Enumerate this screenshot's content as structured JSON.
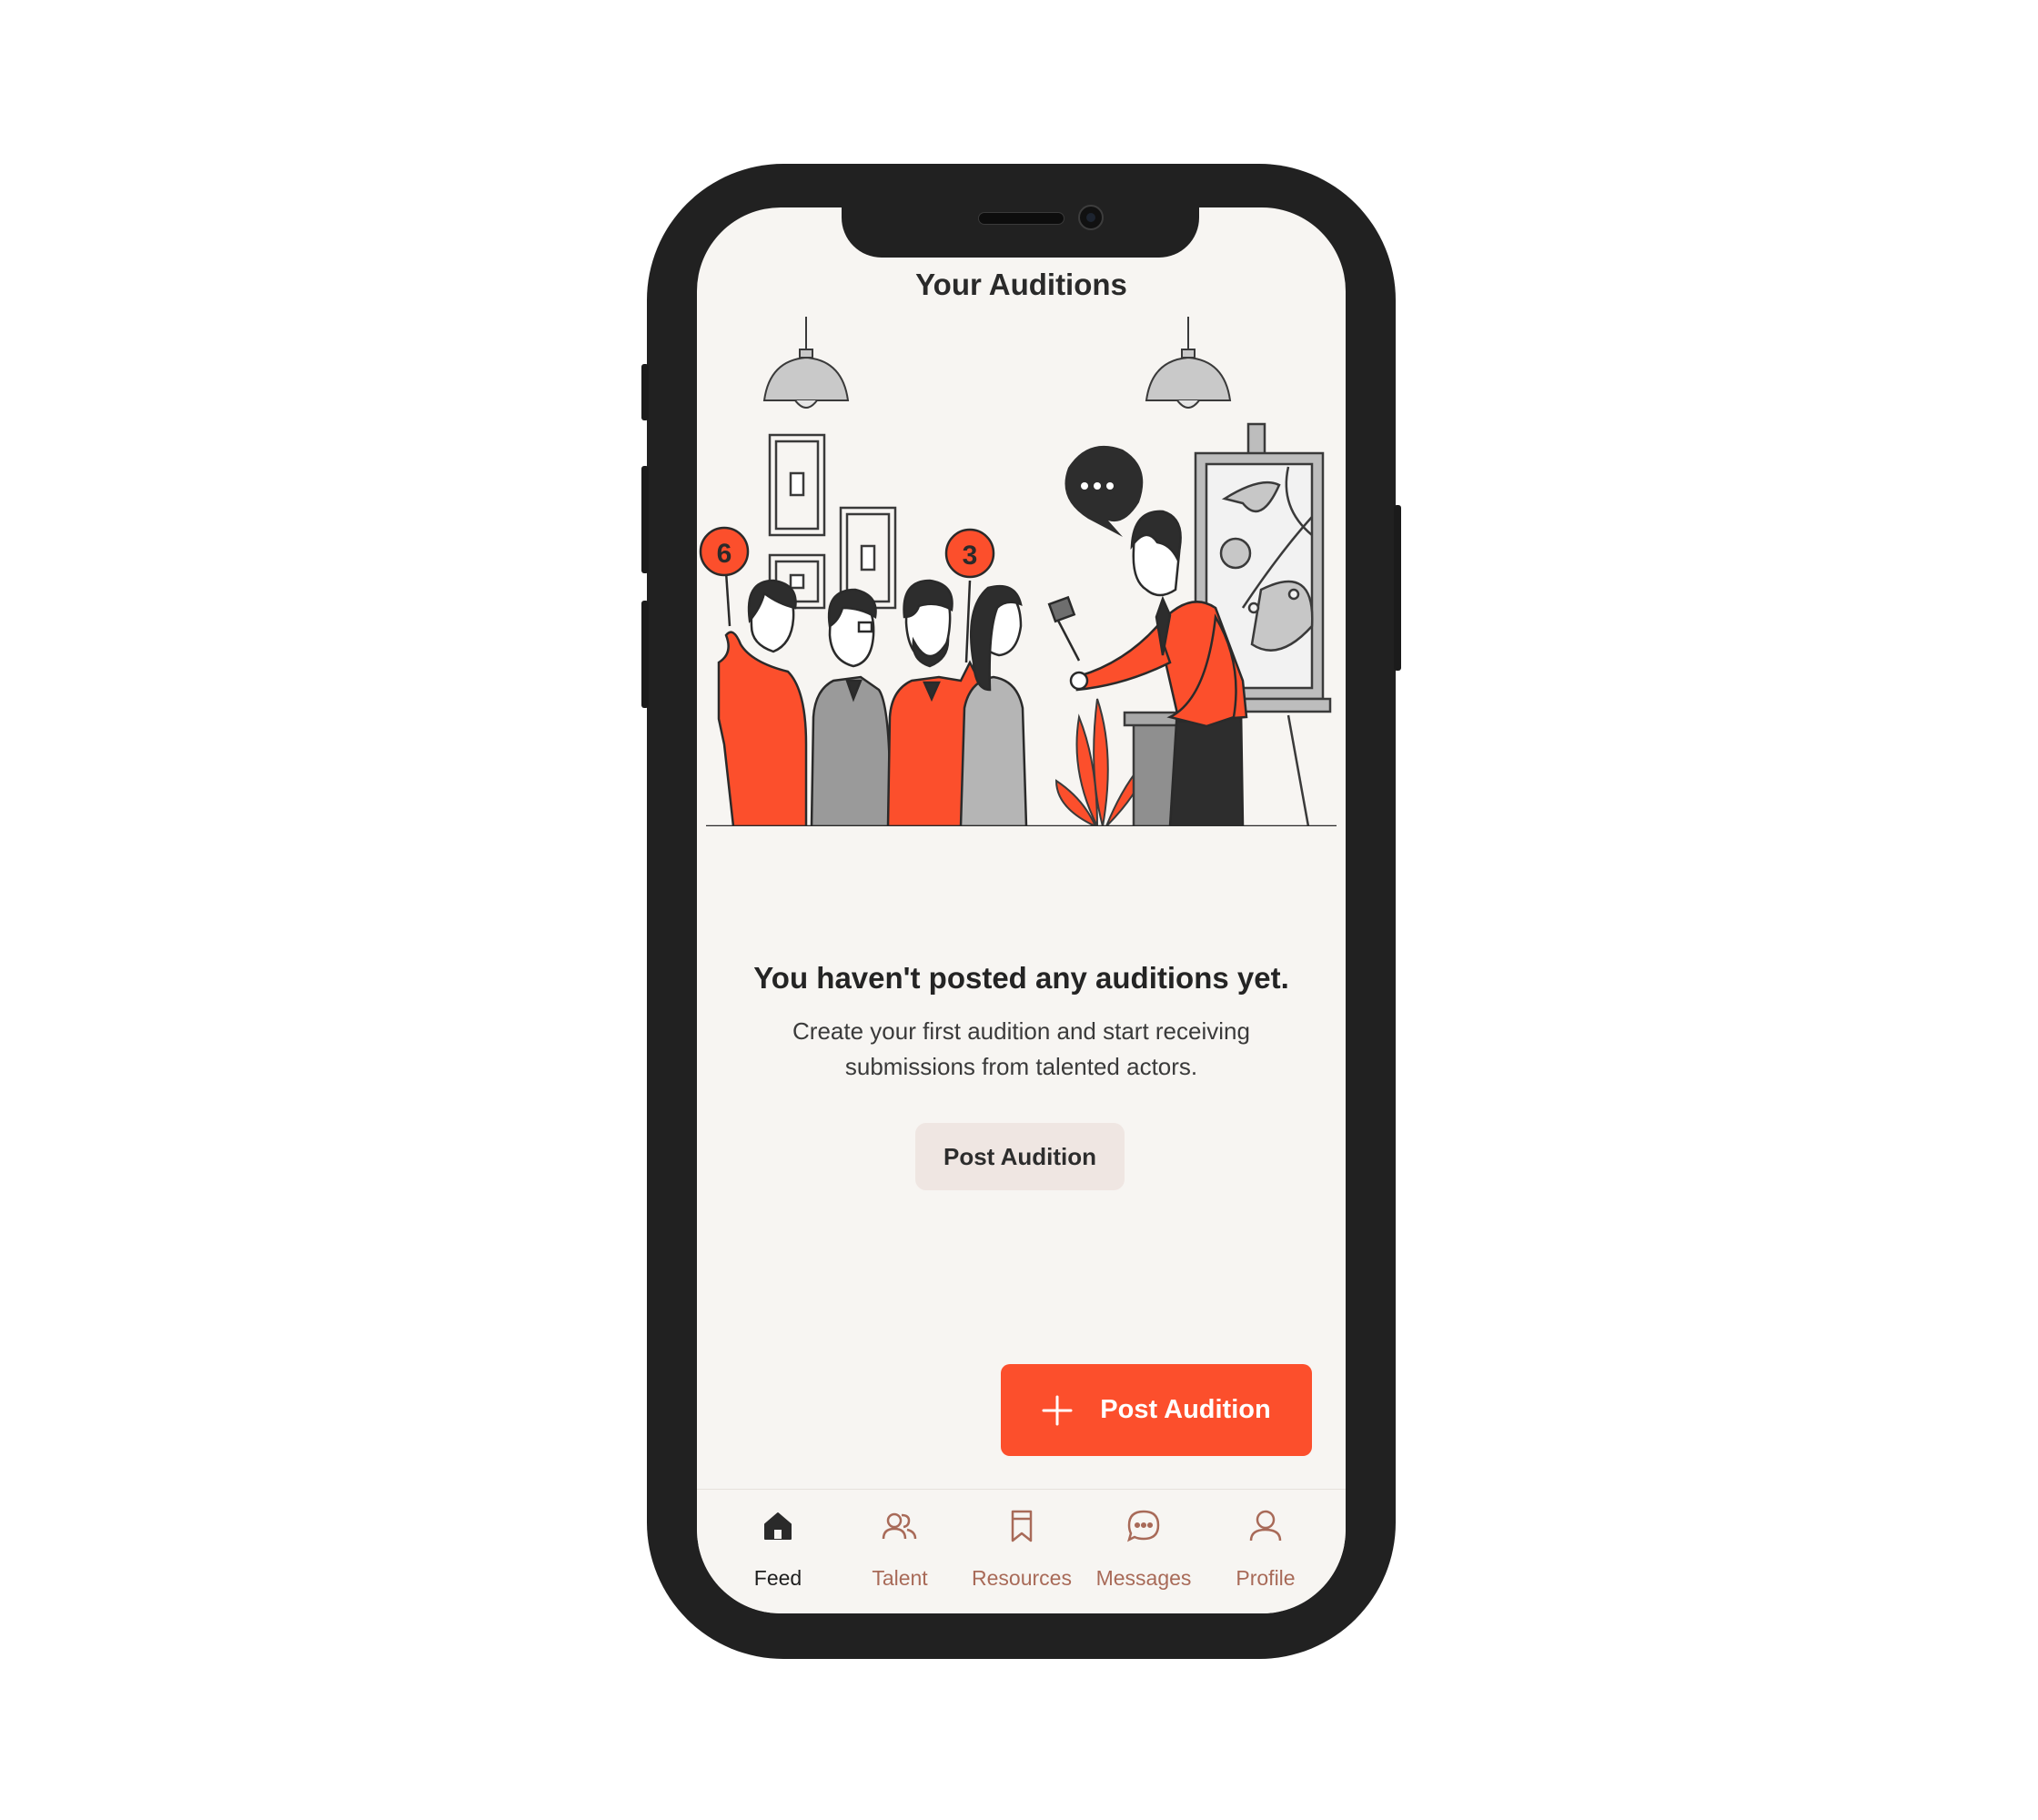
{
  "header": {
    "title": "Your Auditions"
  },
  "illustration": {
    "paddle_numbers": [
      "6",
      "3"
    ]
  },
  "empty_state": {
    "heading": "You haven't posted any auditions yet.",
    "body": "Create your first audition and start receiving submissions from talented actors.",
    "button_label": "Post Audition"
  },
  "fab": {
    "label": "Post Audition",
    "icon": "plus-icon"
  },
  "tabs": [
    {
      "label": "Feed",
      "icon": "home-icon",
      "active": true
    },
    {
      "label": "Talent",
      "icon": "users-icon",
      "active": false
    },
    {
      "label": "Resources",
      "icon": "bookmark-icon",
      "active": false
    },
    {
      "label": "Messages",
      "icon": "chat-icon",
      "active": false
    },
    {
      "label": "Profile",
      "icon": "person-icon",
      "active": false
    }
  ],
  "colors": {
    "accent": "#fc4f2c",
    "background": "#f7f5f2",
    "secondary_button": "#efe6e2",
    "inactive_tab": "#a86a58",
    "frame": "#212121"
  }
}
